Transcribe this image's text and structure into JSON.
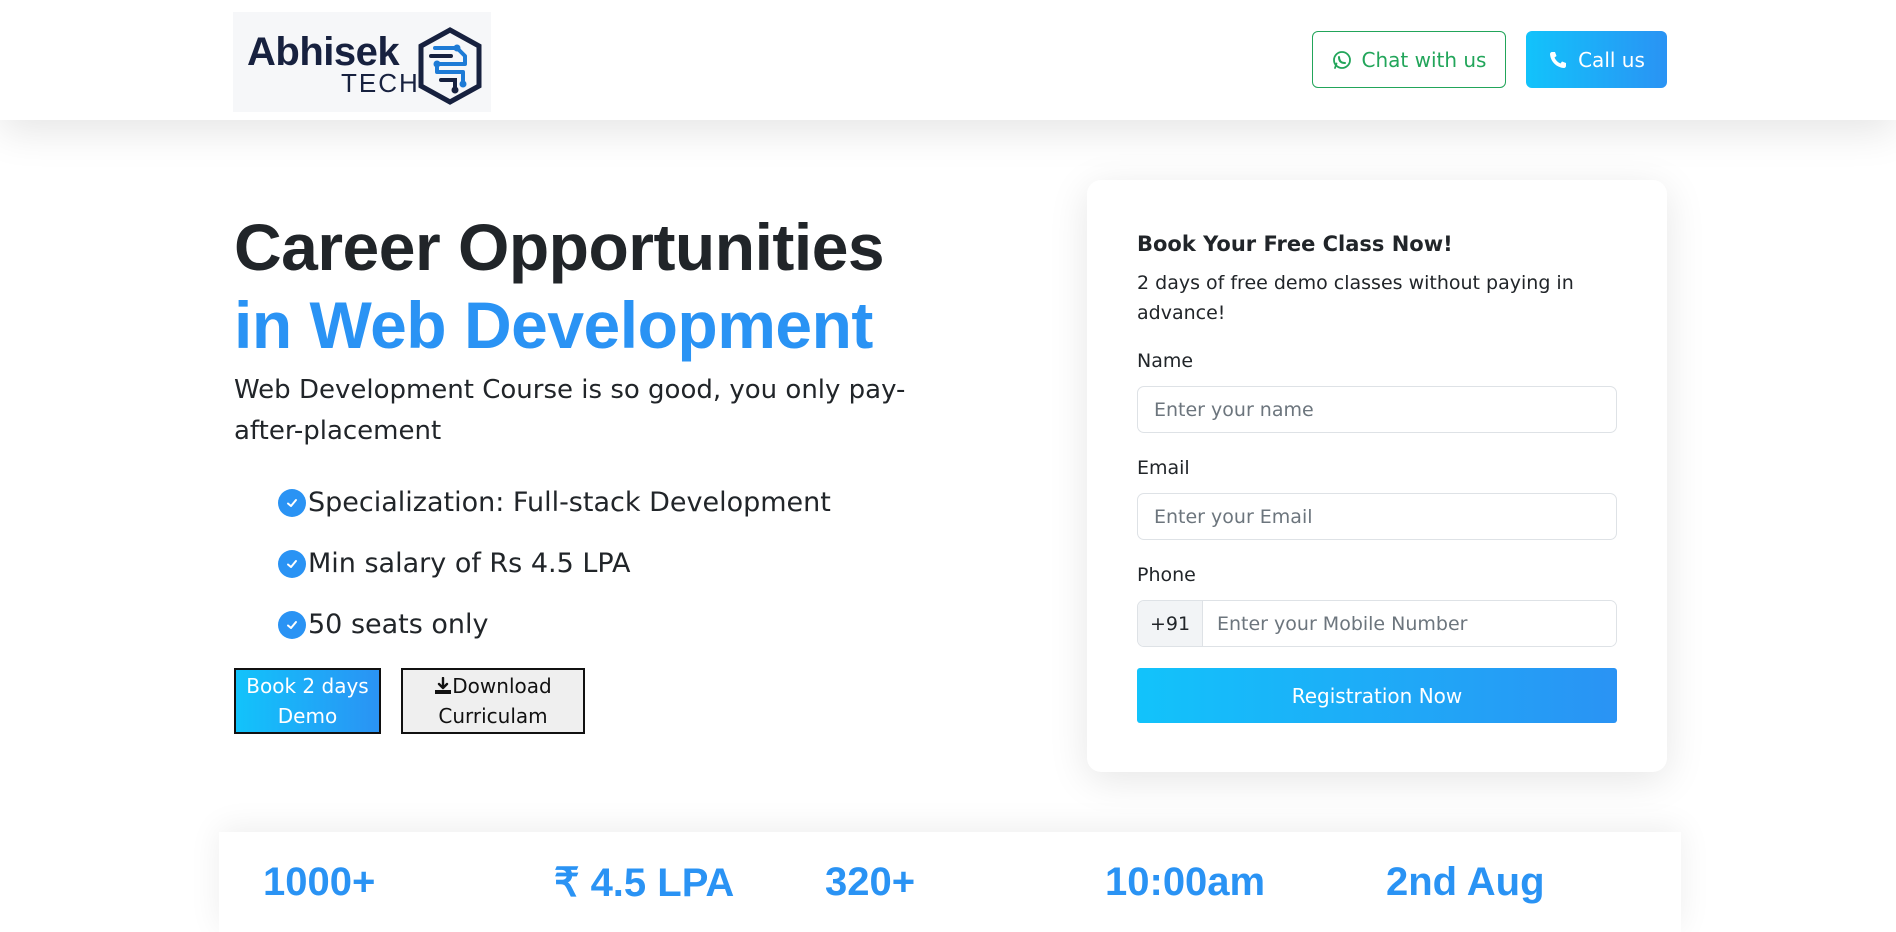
{
  "brand": {
    "name": "Abhisek",
    "sub": "TECH"
  },
  "header": {
    "chat_label": "Chat with us",
    "call_label": "Call us",
    "chat_color": "#22a55a",
    "call_gradient": [
      "#12c3fb",
      "#2a93f4"
    ]
  },
  "hero": {
    "title_line1": "Career Opportunities",
    "title_line2": "in Web Development",
    "subtitle": "Web Development Course is so good, you only pay-after-placement",
    "features": [
      "Specialization: Full-stack Development",
      "Min salary of Rs 4.5 LPA",
      "50 seats only"
    ],
    "demo_button": {
      "line1": "Book 2 days",
      "line2": "Demo"
    },
    "download_button": {
      "line1": "Download",
      "line2": "Curriculam"
    }
  },
  "form": {
    "title": "Book Your Free Class Now!",
    "subtitle": "2 days of free demo classes without paying in advance!",
    "name_label": "Name",
    "name_placeholder": "Enter your name",
    "email_label": "Email",
    "email_placeholder": "Enter your Email",
    "phone_label": "Phone",
    "phone_prefix": "+91",
    "phone_placeholder": "Enter your Mobile Number",
    "submit_label": "Registration Now"
  },
  "stats": [
    "1000+",
    "₹ 4.5 LPA",
    "320+",
    "10:00am",
    "2nd Aug"
  ],
  "colors": {
    "accent": "#2a93f4",
    "accent_light": "#12c3fb",
    "text": "#212529"
  }
}
